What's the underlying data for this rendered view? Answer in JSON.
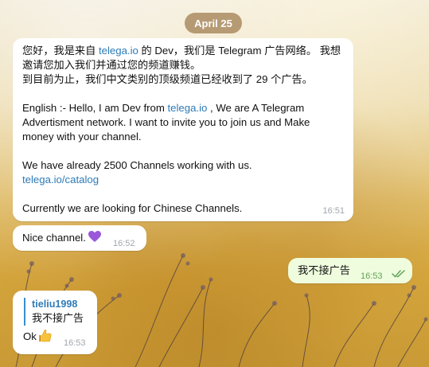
{
  "date_separator": "April 25",
  "messages": [
    {
      "direction": "incoming",
      "lines": {
        "l1_a": "您好，我是来自 ",
        "l1_link": "telega.io",
        "l1_b": " 的 Dev，我们是 Telegram 广告网络。 我想",
        "l2": "邀请您加入我们并通过您的频道赚钱。",
        "l3": "到目前为止，我们中文类别的顶级频道已经收到了 29 个广告。",
        "l5_a": "English :- Hello, I am Dev from ",
        "l5_link": "telega.io",
        "l5_b": " , We are A Telegram",
        "l6": "Advertisment network. I want to invite you to join us and Make",
        "l7": "money with your channel.",
        "l9": "We have already 2500 Channels working with us.",
        "l10_link": "telega.io/catalog",
        "l12": "Currently we are looking for Chinese Channels."
      },
      "time": "16:51"
    },
    {
      "direction": "incoming",
      "text": "Nice channel.",
      "emoji_icon": "purple-heart-icon",
      "time": "16:52"
    },
    {
      "direction": "outgoing",
      "text": "我不接广告",
      "time": "16:53",
      "status_icon": "double-check-icon"
    },
    {
      "direction": "incoming",
      "reply_to": {
        "name": "tieliu1998",
        "text": "我不接广告"
      },
      "text": "Ok",
      "emoji_icon": "thumbs-up-icon",
      "time": "16:53"
    }
  ],
  "colors": {
    "link": "#2c7bb8",
    "outgoing_bubble": "#effdde",
    "check": "#5fa25a",
    "reply_accent": "#3a90d0"
  }
}
